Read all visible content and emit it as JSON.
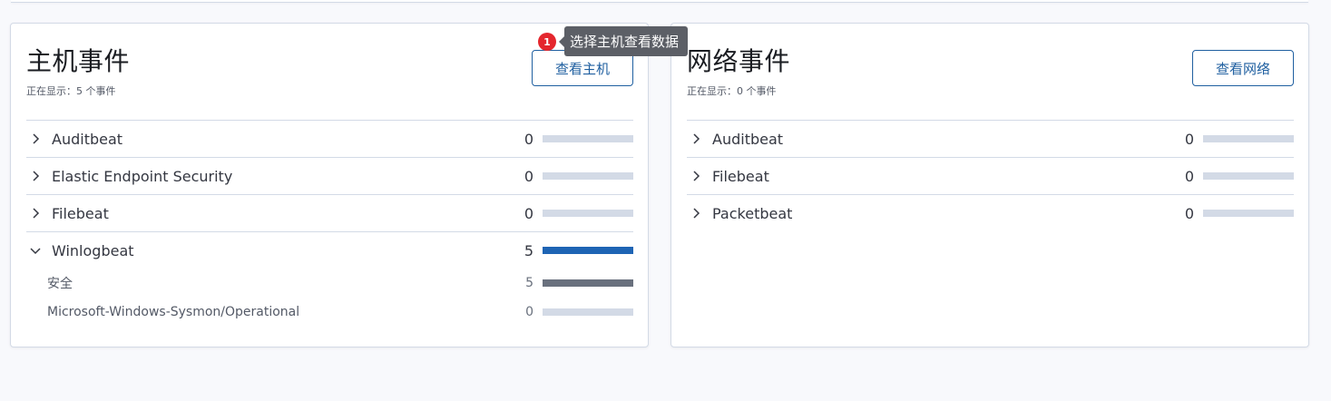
{
  "host": {
    "title": "主机事件",
    "subtitle": "正在显示：5 个事件",
    "button": "查看主机",
    "rows": [
      {
        "label": "Auditbeat",
        "count": "0",
        "fill": 0
      },
      {
        "label": "Elastic Endpoint Security",
        "count": "0",
        "fill": 0
      },
      {
        "label": "Filebeat",
        "count": "0",
        "fill": 0
      },
      {
        "label": "Winlogbeat",
        "count": "5",
        "fill": 1.0
      }
    ],
    "subrows": [
      {
        "label": "安全",
        "count": "5",
        "fill": 1.0
      },
      {
        "label": "Microsoft-Windows-Sysmon/Operational",
        "count": "0",
        "fill": 0
      }
    ]
  },
  "network": {
    "title": "网络事件",
    "subtitle": "正在显示：0 个事件",
    "button": "查看网络",
    "rows": [
      {
        "label": "Auditbeat",
        "count": "0",
        "fill": 0
      },
      {
        "label": "Filebeat",
        "count": "0",
        "fill": 0
      },
      {
        "label": "Packetbeat",
        "count": "0",
        "fill": 0
      }
    ]
  },
  "tooltip": {
    "badge": "1",
    "text": "选择主机查看数据"
  },
  "colors": {
    "primary_bar": "#1e64b4",
    "sub_bar": "#69707d",
    "track": "#d3dae6",
    "badge": "#e4262d"
  }
}
